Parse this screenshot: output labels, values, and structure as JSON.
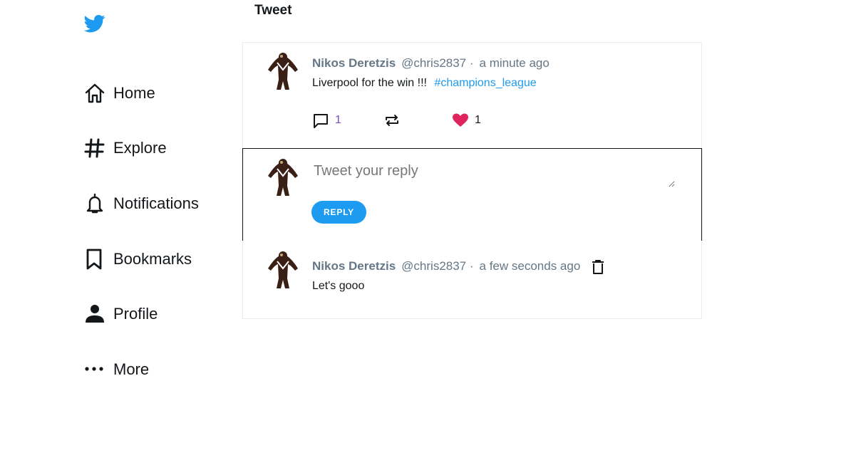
{
  "sidebar": {
    "items": [
      {
        "label": "Home"
      },
      {
        "label": "Explore"
      },
      {
        "label": "Notifications"
      },
      {
        "label": "Bookmarks"
      },
      {
        "label": "Profile"
      },
      {
        "label": "More"
      }
    ]
  },
  "header": {
    "title": "Tweet"
  },
  "tweet": {
    "author": "Nikos Deretzis",
    "handle": "@chris2837 ·",
    "time": "a minute ago",
    "text": "Liverpool for the win !!!",
    "hashtag": "#champions_league",
    "comments": "1",
    "likes": "1",
    "like_color": "#e0245e"
  },
  "reply": {
    "placeholder": "Tweet your reply",
    "button_label": "REPLY"
  },
  "comment": {
    "author": "Nikos Deretzis",
    "handle": "@chris2837 ·",
    "time": "a few seconds ago",
    "text": "Let's gooo"
  },
  "colors": {
    "accent": "#1d9bf0",
    "like": "#e0245e",
    "muted": "#657786"
  }
}
